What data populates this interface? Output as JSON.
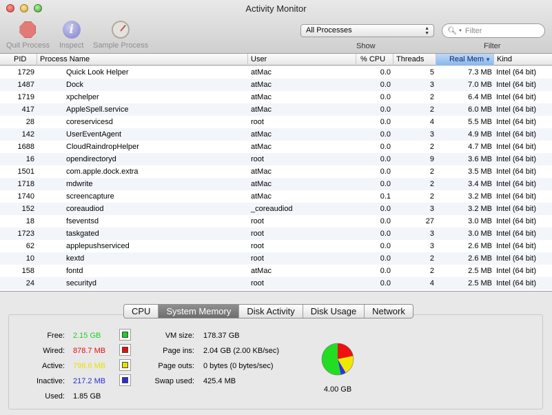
{
  "window": {
    "title": "Activity Monitor"
  },
  "toolbar": {
    "quit_label": "Quit Process",
    "inspect_label": "Inspect",
    "sample_label": "Sample Process",
    "show_value": "All Processes",
    "show_label": "Show",
    "filter_placeholder": "Filter",
    "filter_label": "Filter"
  },
  "columns": {
    "pid": "PID",
    "name": "Process Name",
    "user": "User",
    "cpu": "% CPU",
    "threads": "Threads",
    "mem": "Real Mem",
    "kind": "Kind"
  },
  "processes": [
    {
      "pid": "1729",
      "name": "Quick Look Helper",
      "user": "atMac",
      "cpu": "0.0",
      "threads": "5",
      "mem": "7.3 MB",
      "kind": "Intel (64 bit)"
    },
    {
      "pid": "1487",
      "name": "Dock",
      "user": "atMac",
      "cpu": "0.0",
      "threads": "3",
      "mem": "7.0 MB",
      "kind": "Intel (64 bit)"
    },
    {
      "pid": "1719",
      "name": "xpchelper",
      "user": "atMac",
      "cpu": "0.0",
      "threads": "2",
      "mem": "6.4 MB",
      "kind": "Intel (64 bit)"
    },
    {
      "pid": "417",
      "name": "AppleSpell.service",
      "user": "atMac",
      "cpu": "0.0",
      "threads": "2",
      "mem": "6.0 MB",
      "kind": "Intel (64 bit)"
    },
    {
      "pid": "28",
      "name": "coreservicesd",
      "user": "root",
      "cpu": "0.0",
      "threads": "4",
      "mem": "5.5 MB",
      "kind": "Intel (64 bit)"
    },
    {
      "pid": "142",
      "name": "UserEventAgent",
      "user": "atMac",
      "cpu": "0.0",
      "threads": "3",
      "mem": "4.9 MB",
      "kind": "Intel (64 bit)"
    },
    {
      "pid": "1688",
      "name": "CloudRaindropHelper",
      "user": "atMac",
      "cpu": "0.0",
      "threads": "2",
      "mem": "4.7 MB",
      "kind": "Intel (64 bit)"
    },
    {
      "pid": "16",
      "name": "opendirectoryd",
      "user": "root",
      "cpu": "0.0",
      "threads": "9",
      "mem": "3.6 MB",
      "kind": "Intel (64 bit)"
    },
    {
      "pid": "1501",
      "name": "com.apple.dock.extra",
      "user": "atMac",
      "cpu": "0.0",
      "threads": "2",
      "mem": "3.5 MB",
      "kind": "Intel (64 bit)"
    },
    {
      "pid": "1718",
      "name": "mdwrite",
      "user": "atMac",
      "cpu": "0.0",
      "threads": "2",
      "mem": "3.4 MB",
      "kind": "Intel (64 bit)"
    },
    {
      "pid": "1740",
      "name": "screencapture",
      "user": "atMac",
      "cpu": "0.1",
      "threads": "2",
      "mem": "3.2 MB",
      "kind": "Intel (64 bit)"
    },
    {
      "pid": "152",
      "name": "coreaudiod",
      "user": "_coreaudiod",
      "cpu": "0.0",
      "threads": "3",
      "mem": "3.2 MB",
      "kind": "Intel (64 bit)"
    },
    {
      "pid": "18",
      "name": "fseventsd",
      "user": "root",
      "cpu": "0.0",
      "threads": "27",
      "mem": "3.0 MB",
      "kind": "Intel (64 bit)"
    },
    {
      "pid": "1723",
      "name": "taskgated",
      "user": "root",
      "cpu": "0.0",
      "threads": "3",
      "mem": "3.0 MB",
      "kind": "Intel (64 bit)"
    },
    {
      "pid": "62",
      "name": "applepushserviced",
      "user": "root",
      "cpu": "0.0",
      "threads": "3",
      "mem": "2.6 MB",
      "kind": "Intel (64 bit)"
    },
    {
      "pid": "10",
      "name": "kextd",
      "user": "root",
      "cpu": "0.0",
      "threads": "2",
      "mem": "2.6 MB",
      "kind": "Intel (64 bit)"
    },
    {
      "pid": "158",
      "name": "fontd",
      "user": "atMac",
      "cpu": "0.0",
      "threads": "2",
      "mem": "2.5 MB",
      "kind": "Intel (64 bit)"
    },
    {
      "pid": "24",
      "name": "securityd",
      "user": "root",
      "cpu": "0.0",
      "threads": "4",
      "mem": "2.5 MB",
      "kind": "Intel (64 bit)"
    }
  ],
  "tabs": [
    "CPU",
    "System Memory",
    "Disk Activity",
    "Disk Usage",
    "Network"
  ],
  "active_tab": "System Memory",
  "memory": {
    "free_label": "Free:",
    "free_value": "2.15 GB",
    "free_color": "#22cc22",
    "wired_label": "Wired:",
    "wired_value": "878.7 MB",
    "wired_color": "#e01010",
    "active_label": "Active:",
    "active_value": "798.6 MB",
    "active_color": "#e8e000",
    "inactive_label": "Inactive:",
    "inactive_value": "217.2 MB",
    "inactive_color": "#2a2ad8",
    "used_label": "Used:",
    "used_value": "1.85 GB",
    "vm_size_label": "VM size:",
    "vm_size_value": "178.37 GB",
    "page_ins_label": "Page ins:",
    "page_ins_value": "2.04 GB (2.00 KB/sec)",
    "page_outs_label": "Page outs:",
    "page_outs_value": "0 bytes (0 bytes/sec)",
    "swap_label": "Swap used:",
    "swap_value": "425.4 MB",
    "total": "4.00 GB"
  },
  "chart_data": {
    "type": "pie",
    "categories": [
      "Free",
      "Wired",
      "Active",
      "Inactive"
    ],
    "values": [
      2150,
      878.7,
      798.6,
      217.2
    ],
    "colors": [
      "#22dd22",
      "#ee1111",
      "#f0e800",
      "#3030e0"
    ]
  }
}
